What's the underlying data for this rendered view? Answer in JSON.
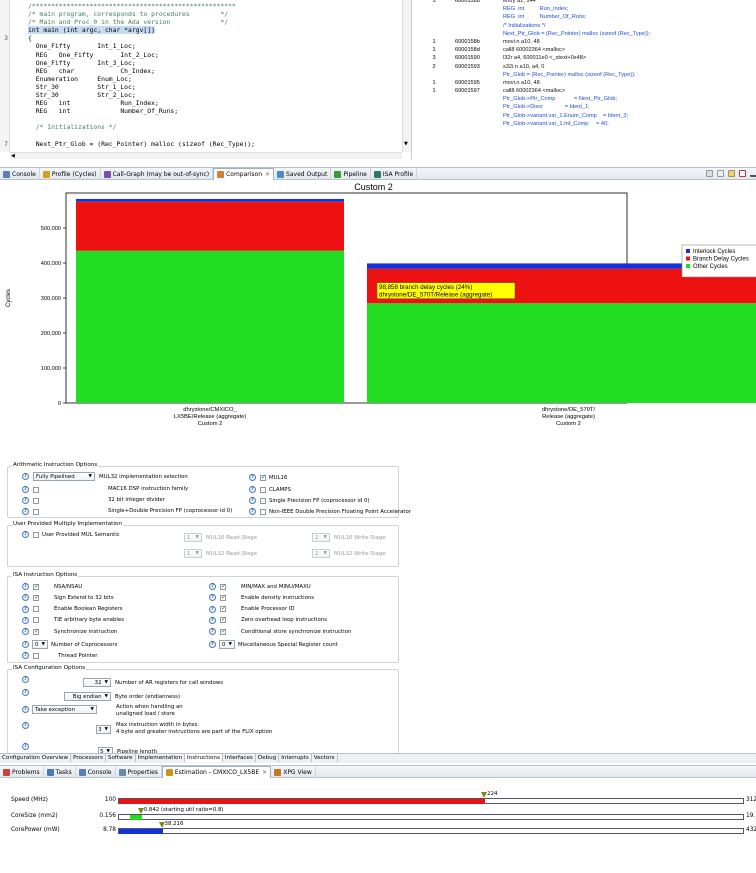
{
  "editor": {
    "code_lines": [
      {
        "num": "",
        "text": "/*****************************************************",
        "cls": "cm"
      },
      {
        "num": "",
        "text": "/* main program, corresponds to procedures        */",
        "cls": "cm"
      },
      {
        "num": "",
        "text": "/* Main and Proc_0 in the Ada version             */",
        "cls": "cm"
      },
      {
        "num": "",
        "text": "int main (int argc, char *argv[])",
        "cls": "hl"
      },
      {
        "num": "3",
        "text": "{",
        "cls": ""
      },
      {
        "num": "",
        "text": "  One_Fifty       Int_1_Loc;",
        "cls": ""
      },
      {
        "num": "",
        "text": "  REG   One_Fifty       Int_2_Loc;",
        "cls": ""
      },
      {
        "num": "",
        "text": "  One_Fifty       Int_3_Loc;",
        "cls": ""
      },
      {
        "num": "",
        "text": "  REG   char            Ch_Index;",
        "cls": ""
      },
      {
        "num": "",
        "text": "  Enumeration     Enum_Loc;",
        "cls": ""
      },
      {
        "num": "",
        "text": "  Str_30          Str_1_Loc;",
        "cls": ""
      },
      {
        "num": "",
        "text": "  Str_30          Str_2_Loc;",
        "cls": ""
      },
      {
        "num": "",
        "text": "  REG   int             Run_Index;",
        "cls": ""
      },
      {
        "num": "",
        "text": "  REG   int             Number_Of_Runs;",
        "cls": ""
      },
      {
        "num": "",
        "text": "",
        "cls": ""
      },
      {
        "num": "",
        "text": "  /* Initializations */",
        "cls": "cm"
      },
      {
        "num": "",
        "text": "",
        "cls": ""
      },
      {
        "num": "7",
        "text": "  Next_Ptr_Glob = (Rec_Pointer) malloc (sizeof (Rec_Type));",
        "cls": ""
      }
    ]
  },
  "disasm": {
    "rows": [
      {
        "line": "5",
        "addr": "6000158b",
        "text": "entry a1, 144"
      },
      {
        "line": "",
        "addr": "",
        "text": "REG  int          Run_Index;"
      },
      {
        "line": "",
        "addr": "",
        "text": "REG  int          Number_Of_Runs;"
      },
      {
        "line": "",
        "addr": "",
        "text": "/* Initializations */"
      },
      {
        "line": "",
        "addr": "",
        "text": "Next_Ptr_Glob = (Rec_Pointer) malloc (sizeof (Rec_Type));"
      },
      {
        "line": "1",
        "addr": "6000158b",
        "text": "movi.n a10, 48"
      },
      {
        "line": "1",
        "addr": "6000158d",
        "text": "call8 60002364 <malloc>"
      },
      {
        "line": "3",
        "addr": "60001590",
        "text": "l32r a4, 600011e0 <_stext+0x48>"
      },
      {
        "line": "2",
        "addr": "60001593",
        "text": "s32i.n a10, a4, 0"
      },
      {
        "line": "",
        "addr": "",
        "text": "Ptr_Glob = (Rec_Pointer) malloc (sizeof (Rec_Type));"
      },
      {
        "line": "1",
        "addr": "60001595",
        "text": "movi.n a10, 48"
      },
      {
        "line": "1",
        "addr": "60001597",
        "text": "call8 60002364 <malloc>"
      },
      {
        "line": "",
        "addr": "",
        "text": "Ptr_Glob->Ptr_Comp            = Next_Ptr_Glob;"
      },
      {
        "line": "",
        "addr": "",
        "text": "Ptr_Glob->Discr              = Ident_1;"
      },
      {
        "line": "",
        "addr": "",
        "text": "Ptr_Glob->variant.var_1.Enum_Comp    = Ident_3;"
      },
      {
        "line": "",
        "addr": "",
        "text": "Ptr_Glob->variant.var_1.Int_Comp     = 40;"
      }
    ]
  },
  "view_tabs": [
    {
      "label": "Console",
      "icon": "console-icon",
      "color": "#5a7fb5"
    },
    {
      "label": "Profile (Cycles)",
      "icon": "profile-icon",
      "color": "#d0a020"
    },
    {
      "label": "Call-Graph (may be out-of-sync)",
      "icon": "call-graph-icon",
      "color": "#7a4fb0"
    },
    {
      "label": "Comparison",
      "icon": "comparison-icon",
      "color": "#d08030",
      "active": true
    },
    {
      "label": "Saved Output",
      "icon": "saved-output-icon",
      "color": "#4a8ad0"
    },
    {
      "label": "Pipeline",
      "icon": "pipeline-icon",
      "color": "#3a9a3a"
    },
    {
      "label": "ISA Profile",
      "icon": "isa-profile-icon",
      "color": "#2a7a6a"
    }
  ],
  "chart_data": {
    "type": "bar",
    "stacked": true,
    "title": "Custom 2",
    "ylabel": "Cycles",
    "ylim": [
      0,
      600000
    ],
    "yticks": [
      0,
      100000,
      200000,
      300000,
      400000,
      500000
    ],
    "ytick_labels": [
      "0",
      "100,000",
      "200,000",
      "300,000",
      "400,000",
      "500,000"
    ],
    "categories": [
      [
        "dhrystone/CMXICO_",
        "LX5BE/Release (aggregate)",
        "Custom 2"
      ],
      [
        "dhrystone/DE_570T/",
        "Release (aggregate)",
        "Custom 2"
      ]
    ],
    "series": [
      {
        "name": "Other Cycles",
        "color": "#22dd22",
        "values": [
          435000,
          285000
        ]
      },
      {
        "name": "Branch Delay Cycles",
        "color": "#ee1111",
        "values": [
          140000,
          98858
        ]
      },
      {
        "name": "Interlock Cycles",
        "color": "#1133dd",
        "values": [
          8000,
          15000
        ]
      }
    ],
    "legend": {
      "placement": "right",
      "order": [
        "Interlock Cycles",
        "Branch Delay Cycles",
        "Other Cycles"
      ]
    },
    "tooltip": {
      "bar": 1,
      "lines": [
        "98,858 branch delay cycles (24%)",
        "dhrystone/DE_570T/Release (aggregate)"
      ]
    },
    "grid": false
  },
  "config": {
    "arith": {
      "title": "Arithmetic Instruction Options",
      "dropdown": "Fully Pipelined",
      "mul32": "MUL32 implementation selection",
      "mul16": "MUL16",
      "mac16": "MAC16 DSP instruction family",
      "clamps": "CLAMPS",
      "int_div": "32 bit integer divider",
      "spfp": "Single Precision FP (coprocessor id 0)",
      "sdpfp": "Single+Double Precision FP (coprocessor id 0)",
      "nonieee": "Non-IEEE Double Precision Floating Point Accelerator"
    },
    "usermul": {
      "title": "User Provided Multiply Implementation",
      "semantic": "User Provided MUL Semantic",
      "mul16_read_val": "1",
      "mul16_read": "MUL16 Read Stage",
      "mul16_write_val": "2",
      "mul16_write": "MUL16 Write Stage",
      "mul32_read_val": "1",
      "mul32_read": "MUL32 Read Stage",
      "mul32_write_val": "2",
      "mul32_write": "MUL32 Write Stage"
    },
    "isa": {
      "title": "ISA Instruction Options",
      "left": [
        {
          "label": "NSA/NSAU",
          "on": true
        },
        {
          "label": "Sign Extend to 32 bits",
          "on": true
        },
        {
          "label": "Enable Boolean Registers",
          "on": false
        },
        {
          "label": "TIE arbitrary byte enables",
          "on": false
        },
        {
          "label": "Synchronize instruction",
          "on": true
        }
      ],
      "right": [
        {
          "label": "MIN/MAX and MINU/MAXU",
          "on": true
        },
        {
          "label": "Enable density instructions",
          "on": true
        },
        {
          "label": "Enable Processor ID",
          "on": true
        },
        {
          "label": "Zero overhead loop instructions",
          "on": true
        },
        {
          "label": "Conditional store synchronize instruction",
          "on": true
        }
      ],
      "coproc_val": "0",
      "coproc": "Number of Coprocessors",
      "misc_val": "0",
      "misc": "Miscellaneous Special Register count",
      "thread": "Thread Pointer"
    },
    "isacfg": {
      "title": "ISA Configuration Options",
      "ar_val": "32",
      "ar": "Number of AR registers for call windows",
      "endian_val": "Big endian",
      "endian": "Byte order (endianness)",
      "unaligned_val": "Take exception",
      "unaligned_1": "Action when handling an",
      "unaligned_2": "unaligned load / store",
      "width_val": "3",
      "width_1": "Max instruction width in bytes.",
      "width_2": "4 byte and greater instructions are part of the FLIX option",
      "pipe_val": "5",
      "pipe": "Pipeline length"
    }
  },
  "config_tabs": [
    "Configuration Overview",
    "Processors",
    "Software",
    "Implementation",
    "Instructions",
    "Interfaces",
    "Debug",
    "Interrupts",
    "Vectors"
  ],
  "bottom_tabs": [
    {
      "label": "Problems",
      "icon": "problems-icon",
      "color": "#d04040"
    },
    {
      "label": "Tasks",
      "icon": "tasks-icon",
      "color": "#4a7ab5"
    },
    {
      "label": "Console",
      "icon": "console-icon",
      "color": "#5a7fb5"
    },
    {
      "label": "Properties",
      "icon": "properties-icon",
      "color": "#6a8aa5"
    },
    {
      "label": "Estimation - CMXICO_LX5BE",
      "icon": "estimation-icon",
      "color": "#d09020",
      "active": true
    },
    {
      "label": "XPG View",
      "icon": "xpg-view-icon",
      "color": "#c07a20"
    }
  ],
  "estimation": [
    {
      "label": "Speed (MHz)",
      "min": "100",
      "max": "312",
      "marker_label": "224",
      "min_v": 100,
      "max_v": 312,
      "marker_v": 224,
      "fill_v": 224,
      "color": "#ee1111"
    },
    {
      "label": "CoreSize (mm2)",
      "min": "0.156",
      "max": "19.",
      "marker_label": "0.842 (starting util ratio=0.8)",
      "min_v": 0.156,
      "max_v": 19,
      "marker_v": 0.842,
      "fill_v": 0.842,
      "fill_from_v": 0.5,
      "color": "#22dd22"
    },
    {
      "label": "CorePower (mW)",
      "min": "8.78",
      "max": "432",
      "marker_label": "38.216",
      "min_v": 8.78,
      "max_v": 432,
      "marker_v": 38.216,
      "fill_v": 38.216,
      "color": "#1133dd"
    }
  ]
}
